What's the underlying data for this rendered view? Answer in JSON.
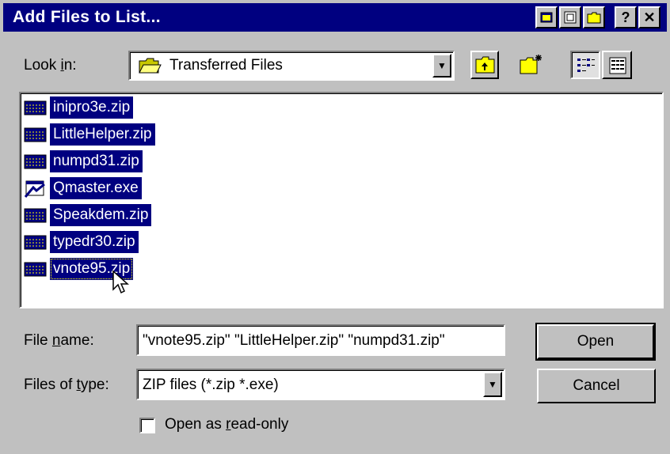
{
  "window": {
    "title": "Add Files to List..."
  },
  "title_buttons": [
    {
      "icon": "window-icon"
    },
    {
      "icon": "restore-icon"
    },
    {
      "icon": "folder-icon"
    },
    {
      "label": "?"
    },
    {
      "label": "✕"
    }
  ],
  "look_in": {
    "label": "Look in:",
    "value": "Transferred Files"
  },
  "toolbar": {
    "up_one_level": "up-folder-icon",
    "new_folder": "new-folder-icon",
    "list_view": "list-view-icon",
    "details_view": "details-view-icon"
  },
  "files": [
    {
      "name": "inipro3e.zip",
      "icon": "zip-icon"
    },
    {
      "name": "LittleHelper.zip",
      "icon": "zip-icon"
    },
    {
      "name": "numpd31.zip",
      "icon": "zip-icon"
    },
    {
      "name": "Qmaster.exe",
      "icon": "exe-icon"
    },
    {
      "name": "Speakdem.zip",
      "icon": "zip-icon"
    },
    {
      "name": "typedr30.zip",
      "icon": "zip-icon"
    },
    {
      "name": "vnote95.zip",
      "icon": "zip-icon"
    }
  ],
  "file_name": {
    "label": "File name:",
    "value": "\"vnote95.zip\" \"LittleHelper.zip\" \"numpd31.zip\""
  },
  "file_type": {
    "label": "Files of type:",
    "value": "ZIP files (*.zip *.exe)"
  },
  "read_only": {
    "label": "Open as read-only",
    "checked": false
  },
  "buttons": {
    "open": "Open",
    "cancel": "Cancel"
  },
  "colors": {
    "title_bar": "#000080",
    "selection": "#000080",
    "face": "#c0c0c0"
  }
}
